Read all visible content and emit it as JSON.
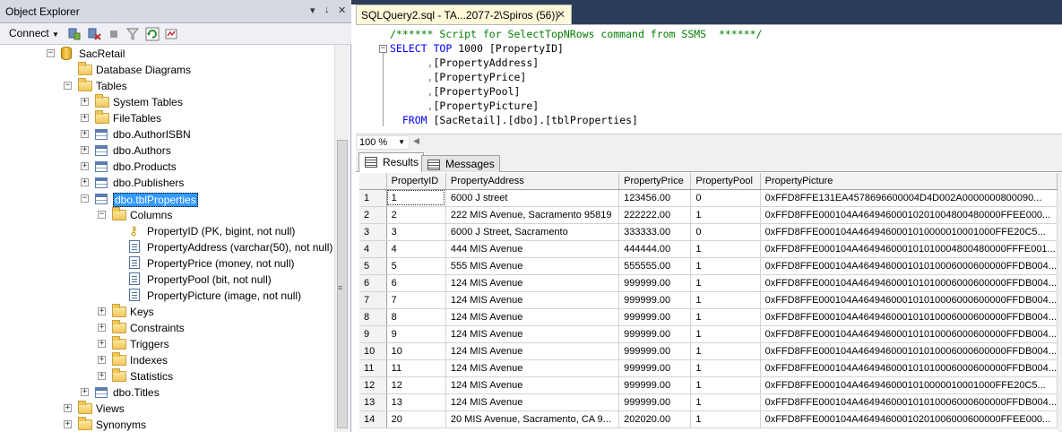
{
  "object_explorer": {
    "title": "Object Explorer",
    "title_controls": [
      "▾",
      "↓",
      "✕"
    ],
    "connect_label": "Connect",
    "tree": [
      {
        "label": "SacRetail",
        "icon": "database-icon",
        "exp": "-",
        "level": 0
      },
      {
        "label": "Database Diagrams",
        "icon": "folder-icon",
        "exp": "",
        "level": 1
      },
      {
        "label": "Tables",
        "icon": "folder-icon",
        "exp": "-",
        "level": 1
      },
      {
        "label": "System Tables",
        "icon": "folder-icon",
        "exp": "+",
        "level": 2
      },
      {
        "label": "FileTables",
        "icon": "folder-icon",
        "exp": "+",
        "level": 2
      },
      {
        "label": "dbo.AuthorISBN",
        "icon": "table-icon",
        "exp": "+",
        "level": 2
      },
      {
        "label": "dbo.Authors",
        "icon": "table-icon",
        "exp": "+",
        "level": 2
      },
      {
        "label": "dbo.Products",
        "icon": "table-icon",
        "exp": "+",
        "level": 2
      },
      {
        "label": "dbo.Publishers",
        "icon": "table-icon",
        "exp": "+",
        "level": 2
      },
      {
        "label": "dbo.tblProperties",
        "icon": "table-icon",
        "exp": "-",
        "level": 2,
        "selected": true
      },
      {
        "label": "Columns",
        "icon": "folder-icon",
        "exp": "-",
        "level": 3
      },
      {
        "label": "PropertyID (PK, bigint, not null)",
        "icon": "key-icon",
        "exp": "",
        "level": 4
      },
      {
        "label": "PropertyAddress (varchar(50), not null)",
        "icon": "column-icon",
        "exp": "",
        "level": 4
      },
      {
        "label": "PropertyPrice (money, not null)",
        "icon": "column-icon",
        "exp": "",
        "level": 4
      },
      {
        "label": "PropertyPool (bit, not null)",
        "icon": "column-icon",
        "exp": "",
        "level": 4
      },
      {
        "label": "PropertyPicture (image, not null)",
        "icon": "column-icon",
        "exp": "",
        "level": 4
      },
      {
        "label": "Keys",
        "icon": "folder-icon",
        "exp": "+",
        "level": 3
      },
      {
        "label": "Constraints",
        "icon": "folder-icon",
        "exp": "+",
        "level": 3
      },
      {
        "label": "Triggers",
        "icon": "folder-icon",
        "exp": "+",
        "level": 3
      },
      {
        "label": "Indexes",
        "icon": "folder-icon",
        "exp": "+",
        "level": 3
      },
      {
        "label": "Statistics",
        "icon": "folder-icon",
        "exp": "+",
        "level": 3
      },
      {
        "label": "dbo.Titles",
        "icon": "table-icon",
        "exp": "+",
        "level": 2
      },
      {
        "label": "Views",
        "icon": "folder-icon",
        "exp": "+",
        "level": 1
      },
      {
        "label": "Synonyms",
        "icon": "folder-icon",
        "exp": "+",
        "level": 1
      }
    ]
  },
  "query_tab": {
    "title": "SQLQuery2.sql - TA...2077-2\\Spiros (56))",
    "close": "✕"
  },
  "editor": {
    "comment": "/****** Script for SelectTopNRows command from SSMS  ******/",
    "select_kw": "SELECT",
    "top_kw": "TOP",
    "top_n": "1000",
    "first_col": "[PropertyID]",
    "columns": [
      "[PropertyAddress]",
      "[PropertyPrice]",
      "[PropertyPool]",
      "[PropertyPicture]"
    ],
    "from_kw": "FROM",
    "from_table": "[SacRetail].[dbo].[tblProperties]",
    "zoom": "100 %"
  },
  "results": {
    "tabs": [
      "Results",
      "Messages"
    ],
    "headers": [
      "PropertyID",
      "PropertyAddress",
      "PropertyPrice",
      "PropertyPool",
      "PropertyPicture"
    ],
    "rows": [
      [
        "1",
        "1",
        "6000 J street",
        "123456.00",
        "0",
        "0xFFD8FFE131EA4578696600004D4D002A0000000800090..."
      ],
      [
        "2",
        "2",
        "222 MIS Avenue, Sacramento 95819",
        "222222.00",
        "1",
        "0xFFD8FFE000104A46494600010201004800480000FFEE000..."
      ],
      [
        "3",
        "3",
        "6000 J Street, Sacramento",
        "333333.00",
        "0",
        "0xFFD8FFE000104A4649460001010000010001000FFE20C5..."
      ],
      [
        "4",
        "4",
        "444 MIS Avenue",
        "444444.00",
        "1",
        "0xFFD8FFE000104A464946000101010004800480000FFFE001..."
      ],
      [
        "5",
        "5",
        "555 MIS Avenue",
        "555555.00",
        "1",
        "0xFFD8FFE000104A464946000101010006000600000FFDB004..."
      ],
      [
        "6",
        "6",
        "124 MIS Avenue",
        "999999.00",
        "1",
        "0xFFD8FFE000104A464946000101010006000600000FFDB004..."
      ],
      [
        "7",
        "7",
        "124 MIS Avenue",
        "999999.00",
        "1",
        "0xFFD8FFE000104A464946000101010006000600000FFDB004..."
      ],
      [
        "8",
        "8",
        "124 MIS Avenue",
        "999999.00",
        "1",
        "0xFFD8FFE000104A464946000101010006000600000FFDB004..."
      ],
      [
        "9",
        "9",
        "124 MIS Avenue",
        "999999.00",
        "1",
        "0xFFD8FFE000104A464946000101010006000600000FFDB004..."
      ],
      [
        "10",
        "10",
        "124 MIS Avenue",
        "999999.00",
        "1",
        "0xFFD8FFE000104A464946000101010006000600000FFDB004..."
      ],
      [
        "11",
        "11",
        "124 MIS Avenue",
        "999999.00",
        "1",
        "0xFFD8FFE000104A464946000101010006000600000FFDB004..."
      ],
      [
        "12",
        "12",
        "124 MIS Avenue",
        "999999.00",
        "1",
        "0xFFD8FFE000104A4649460001010000010001000FFE20C5..."
      ],
      [
        "13",
        "13",
        "124 MIS Avenue",
        "999999.00",
        "1",
        "0xFFD8FFE000104A464946000101010006000600000FFDB004..."
      ],
      [
        "14",
        "20",
        "20 MIS Avenue, Sacramento, CA 9...",
        "202020.00",
        "1",
        "0xFFD8FFE000104A46494600010201006000600000FFEE000..."
      ]
    ]
  },
  "colors": {
    "tab_strip": "#2b3c59",
    "active_tab": "#fff8d9",
    "keyword": "#0000ff",
    "comment": "#008000",
    "selection": "#3399ff"
  }
}
